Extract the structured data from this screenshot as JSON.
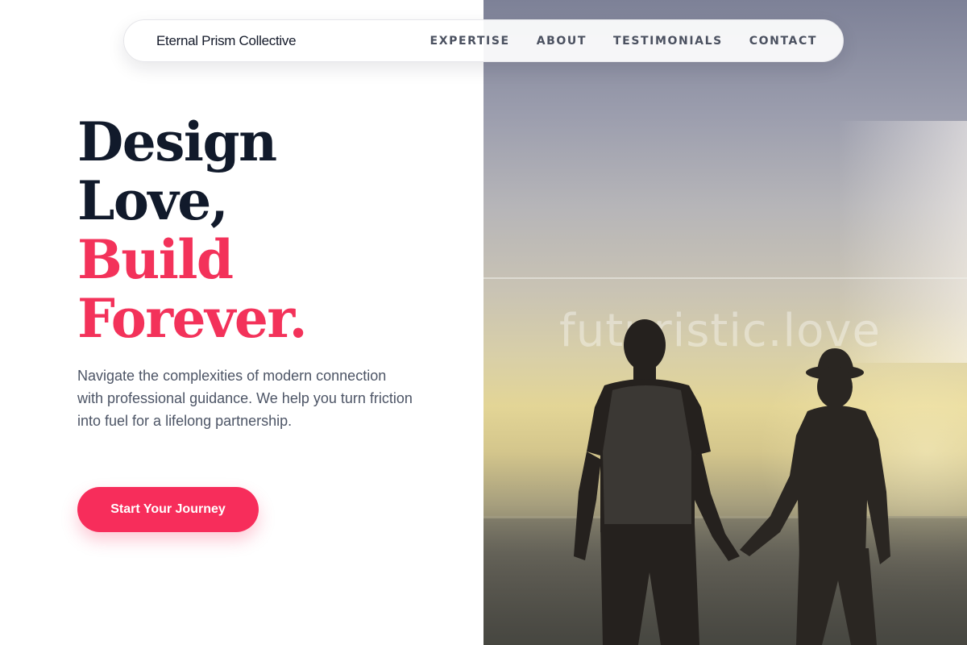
{
  "nav": {
    "brand": "Eternal Prism Collective",
    "links": [
      "EXPERTISE",
      "ABOUT",
      "TESTIMONIALS",
      "CONTACT"
    ]
  },
  "hero": {
    "headline": {
      "line1": "Design",
      "line2": "Love,",
      "line3": "Build",
      "line4": "Forever."
    },
    "description": "Navigate the complexities of modern connection with professional guidance. We help you turn friction into fuel for a lifelong partnership.",
    "cta_label": "Start Your Journey",
    "image_watermark": "futuristic.love"
  },
  "colors": {
    "accent": "#f72d5b",
    "heading_dark": "#111a2b",
    "body_text": "#4d5566"
  }
}
